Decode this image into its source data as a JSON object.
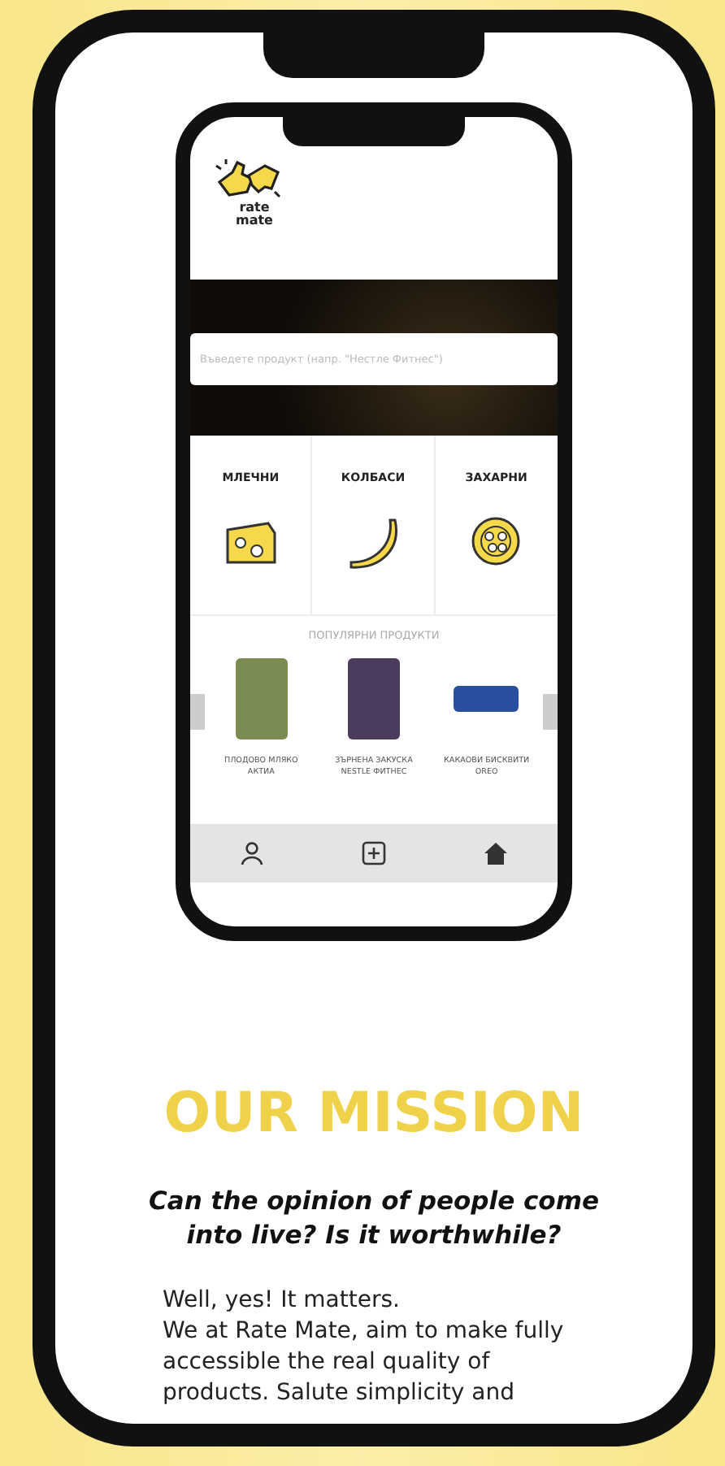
{
  "app_preview": {
    "logo": {
      "lines": [
        "rate",
        "mate"
      ]
    },
    "search": {
      "placeholder": "Въведете продукт (напр. \"Нестле Фитнес\")"
    },
    "categories": [
      {
        "label": "МЛЕЧНИ",
        "kind": "cheese"
      },
      {
        "label": "КОЛБАСИ",
        "kind": "banana"
      },
      {
        "label": "ЗАХАРНИ",
        "kind": "cookie"
      }
    ],
    "popular_title": "ПОПУЛЯРНИ ПРОДУКТИ",
    "products": [
      {
        "name": "ПЛОДОВО МЛЯКО АКТИА"
      },
      {
        "name": "ЗЪРНЕНА ЗАКУСКА NESTLE ФИТНЕС"
      },
      {
        "name": "КАКАОВИ БИСКВИТИ OREO"
      }
    ],
    "nav": [
      {
        "kind": "user"
      },
      {
        "kind": "add"
      },
      {
        "kind": "home"
      }
    ]
  },
  "mission": {
    "title": "OUR MISSION",
    "question": "Can the opinion of people come into live? Is it worthwhile?",
    "body": [
      "Well, yes! It matters.",
      "We at Rate Mate, aim to make fully accessible the real quality of products. Salute simplicity and"
    ]
  }
}
